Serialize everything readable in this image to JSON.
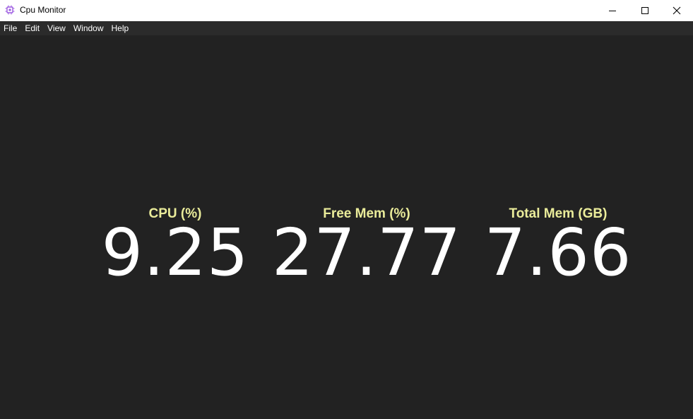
{
  "window": {
    "title": "Cpu Monitor",
    "icon": "cpu-chip-icon",
    "icon_color": "#9b59e0"
  },
  "menu": {
    "items": [
      "File",
      "Edit",
      "View",
      "Window",
      "Help"
    ]
  },
  "metrics": {
    "cpu": {
      "label": "CPU (%)",
      "value": "9.25"
    },
    "free_mem": {
      "label": "Free Mem (%)",
      "value": "27.77"
    },
    "total_mem": {
      "label": "Total Mem (GB)",
      "value": "7.66"
    }
  },
  "colors": {
    "background": "#222222",
    "menubar": "#2b2b2b",
    "label": "#eaec9a",
    "value": "#ffffff"
  }
}
